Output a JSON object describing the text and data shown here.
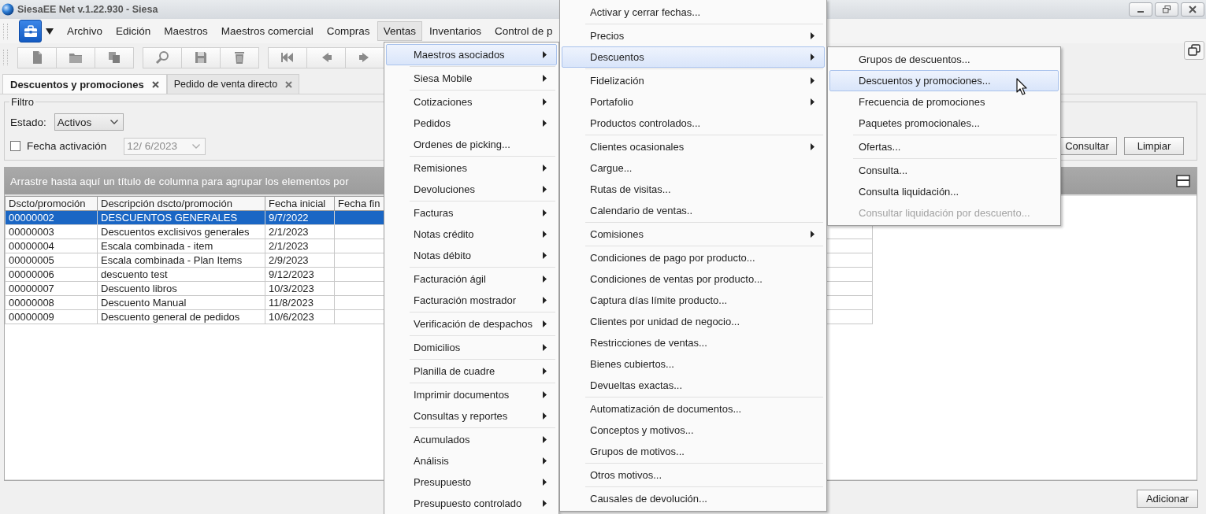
{
  "window": {
    "title": "SiesaEE Net v.1.22.930 - Siesa"
  },
  "menu_bar": {
    "items": [
      {
        "label": "Archivo",
        "selected": false
      },
      {
        "label": "Edición",
        "selected": false
      },
      {
        "label": "Maestros",
        "selected": false
      },
      {
        "label": "Maestros comercial",
        "selected": false
      },
      {
        "label": "Compras",
        "selected": false
      },
      {
        "label": "Ventas",
        "selected": true
      },
      {
        "label": "Inventarios",
        "selected": false
      },
      {
        "label": "Control de p",
        "selected": false
      }
    ]
  },
  "toolbar": {
    "groups": [
      [
        {
          "kind": "document"
        },
        {
          "kind": "folder"
        },
        {
          "kind": "copy"
        }
      ],
      [
        {
          "kind": "search"
        },
        {
          "kind": "save"
        },
        {
          "kind": "trash"
        }
      ],
      [
        {
          "kind": "first"
        },
        {
          "kind": "previous"
        },
        {
          "kind": "next"
        }
      ]
    ]
  },
  "tabs": [
    {
      "label": "Descuentos y promociones",
      "selected": true
    },
    {
      "label": "Pedido de venta directo",
      "selected": false
    }
  ],
  "filter": {
    "title": "Filtro",
    "state_label": "Estado:",
    "state_value": "Activos",
    "date_checkbox": {
      "label": "Fecha activación",
      "checked": false
    },
    "date_field": {
      "value": "12/ 6/2023",
      "disabled": true
    },
    "buttons": [
      "Consultar",
      "Limpiar"
    ]
  },
  "grid": {
    "group_hint": "Arrastre hasta aquí un título de columna para agrupar los elementos por",
    "columns": [
      "Dscto/promoción",
      "Descripción dscto/promoción",
      "Fecha inicial",
      "Fecha fin"
    ],
    "rows": [
      {
        "cells": [
          "00000002",
          "DESCUENTOS GENERALES",
          "9/7/2022"
        ],
        "selected": true
      },
      {
        "cells": [
          "00000003",
          "Descuentos exclisivos generales",
          "2/1/2023"
        ],
        "selected": false
      },
      {
        "cells": [
          "00000004",
          "Escala combinada - item",
          "2/1/2023"
        ],
        "selected": false
      },
      {
        "cells": [
          "00000005",
          "Escala combinada - Plan Items",
          "2/9/2023"
        ],
        "selected": false
      },
      {
        "cells": [
          "00000006",
          "descuento test",
          "9/12/2023"
        ],
        "selected": false
      },
      {
        "cells": [
          "00000007",
          "Descuento libros",
          "10/3/2023"
        ],
        "selected": false
      },
      {
        "cells": [
          "00000008",
          "Descuento Manual",
          "11/8/2023"
        ],
        "selected": false
      },
      {
        "cells": [
          "00000009",
          "Descuento general de pedidos",
          "10/6/2023"
        ],
        "selected": false
      }
    ]
  },
  "footer": {
    "buttons": [
      "Adicionar"
    ]
  },
  "menus": [
    {
      "groups": [
        [
          {
            "label": "Maestros asociados",
            "submenu": true,
            "selected": true
          }
        ],
        [
          {
            "label": "Siesa Mobile",
            "submenu": true,
            "selected": false
          }
        ],
        [
          {
            "label": "Cotizaciones",
            "submenu": true,
            "selected": false
          },
          {
            "label": "Pedidos",
            "submenu": true,
            "selected": false
          },
          {
            "label": "Ordenes de picking...",
            "submenu": false,
            "selected": false
          }
        ],
        [
          {
            "label": "Remisiones",
            "submenu": true,
            "selected": false
          },
          {
            "label": "Devoluciones",
            "submenu": true,
            "selected": false
          }
        ],
        [
          {
            "label": "Facturas",
            "submenu": true,
            "selected": false
          },
          {
            "label": "Notas crédito",
            "submenu": true,
            "selected": false
          },
          {
            "label": "Notas débito",
            "submenu": true,
            "selected": false
          }
        ],
        [
          {
            "label": "Facturación ágil",
            "submenu": true,
            "selected": false
          },
          {
            "label": "Facturación mostrador",
            "submenu": true,
            "selected": false
          }
        ],
        [
          {
            "label": "Verificación de despachos",
            "submenu": true,
            "selected": false
          }
        ],
        [
          {
            "label": "Domicilios",
            "submenu": true,
            "selected": false
          }
        ],
        [
          {
            "label": "Planilla de cuadre",
            "submenu": true,
            "selected": false
          }
        ],
        [
          {
            "label": "Imprimir documentos",
            "submenu": true,
            "selected": false
          },
          {
            "label": "Consultas y reportes",
            "submenu": true,
            "selected": false
          }
        ],
        [
          {
            "label": "Acumulados",
            "submenu": true,
            "selected": false
          },
          {
            "label": "Análisis",
            "submenu": true,
            "selected": false
          },
          {
            "label": "Presupuesto",
            "submenu": true,
            "selected": false
          },
          {
            "label": "Presupuesto controlado",
            "submenu": true,
            "selected": false
          }
        ]
      ]
    },
    {
      "groups": [
        [
          {
            "label": "Activar y cerrar fechas...",
            "submenu": false,
            "selected": false
          }
        ],
        [
          {
            "label": "Precios",
            "submenu": true,
            "selected": false
          },
          {
            "label": "Descuentos",
            "submenu": true,
            "selected": true
          }
        ],
        [
          {
            "label": "Fidelización",
            "submenu": true,
            "selected": false
          },
          {
            "label": "Portafolio",
            "submenu": true,
            "selected": false
          },
          {
            "label": "Productos controlados...",
            "submenu": false,
            "selected": false
          }
        ],
        [
          {
            "label": "Clientes ocasionales",
            "submenu": true,
            "selected": false
          },
          {
            "label": "Cargue...",
            "submenu": false,
            "selected": false
          },
          {
            "label": "Rutas de visitas...",
            "submenu": false,
            "selected": false
          },
          {
            "label": "Calendario de ventas..",
            "submenu": false,
            "selected": false
          }
        ],
        [
          {
            "label": "Comisiones",
            "submenu": true,
            "selected": false
          }
        ],
        [
          {
            "label": "Condiciones de pago por producto...",
            "submenu": false,
            "selected": false
          },
          {
            "label": "Condiciones de ventas por producto...",
            "submenu": false,
            "selected": false
          },
          {
            "label": "Captura días límite producto...",
            "submenu": false,
            "selected": false
          },
          {
            "label": "Clientes por unidad de negocio...",
            "submenu": false,
            "selected": false
          },
          {
            "label": "Restricciones de ventas...",
            "submenu": false,
            "selected": false
          },
          {
            "label": "Bienes cubiertos...",
            "submenu": false,
            "selected": false
          },
          {
            "label": "Devueltas exactas...",
            "submenu": false,
            "selected": false
          }
        ],
        [
          {
            "label": "Automatización de documentos...",
            "submenu": false,
            "selected": false
          },
          {
            "label": "Conceptos y motivos...",
            "submenu": false,
            "selected": false
          },
          {
            "label": "Grupos de motivos...",
            "submenu": false,
            "selected": false
          }
        ],
        [
          {
            "label": "Otros motivos...",
            "submenu": false,
            "selected": false
          }
        ],
        [
          {
            "label": "Causales de devolución...",
            "submenu": false,
            "selected": false
          }
        ]
      ]
    },
    {
      "groups": [
        [
          {
            "label": "Grupos de descuentos...",
            "submenu": false,
            "selected": false,
            "disabled": false
          },
          {
            "label": "Descuentos y promociones...",
            "submenu": false,
            "selected": true,
            "disabled": false
          },
          {
            "label": "Frecuencia de promociones",
            "submenu": false,
            "selected": false,
            "disabled": false
          },
          {
            "label": "Paquetes promocionales...",
            "submenu": false,
            "selected": false,
            "disabled": false
          }
        ],
        [
          {
            "label": "Ofertas...",
            "submenu": false,
            "selected": false,
            "disabled": false
          }
        ],
        [
          {
            "label": "Consulta...",
            "submenu": false,
            "selected": false,
            "disabled": false
          },
          {
            "label": "Consulta liquidación...",
            "submenu": false,
            "selected": false,
            "disabled": false
          },
          {
            "label": "Consultar liquidación por descuento...",
            "submenu": false,
            "selected": false,
            "disabled": true
          }
        ]
      ]
    }
  ]
}
